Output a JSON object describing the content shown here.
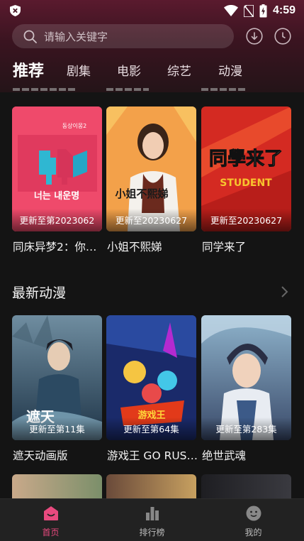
{
  "status_bar": {
    "time": "4:59"
  },
  "search": {
    "placeholder": "请输入关键字"
  },
  "tabs": [
    {
      "label": "推荐",
      "active": true
    },
    {
      "label": "剧集"
    },
    {
      "label": "电影"
    },
    {
      "label": "综艺"
    },
    {
      "label": "动漫"
    }
  ],
  "drama_row": {
    "items": [
      {
        "title": "同床异梦2：你…",
        "episode": "更新至第2023062"
      },
      {
        "title": "小姐不熙娣",
        "episode": "更新至20230627"
      },
      {
        "title": "同学来了",
        "episode": "更新至20230627"
      }
    ]
  },
  "anime_section": {
    "title": "最新动漫",
    "items": [
      {
        "title": "遮天动画版",
        "episode": "更新至第11集"
      },
      {
        "title": "游戏王 GO RUS…",
        "episode": "更新至第64集"
      },
      {
        "title": "绝世武魂",
        "episode": "更新至第283集"
      }
    ]
  },
  "poster_text": {
    "p1_top": "동상이몽2",
    "p1_main": "너는 내운명",
    "p2_main": "小姐不熙娣",
    "p3_main": "同學来了",
    "p3_sub": "STUDENT",
    "p4_main": "遮天",
    "p5_main": "游戏王"
  },
  "bottom_nav": [
    {
      "label": "首页",
      "active": true
    },
    {
      "label": "排行榜"
    },
    {
      "label": "我的"
    }
  ],
  "colors": {
    "accent": "#e94a7f",
    "background": "#141414",
    "header_top": "#5a1a2e"
  }
}
